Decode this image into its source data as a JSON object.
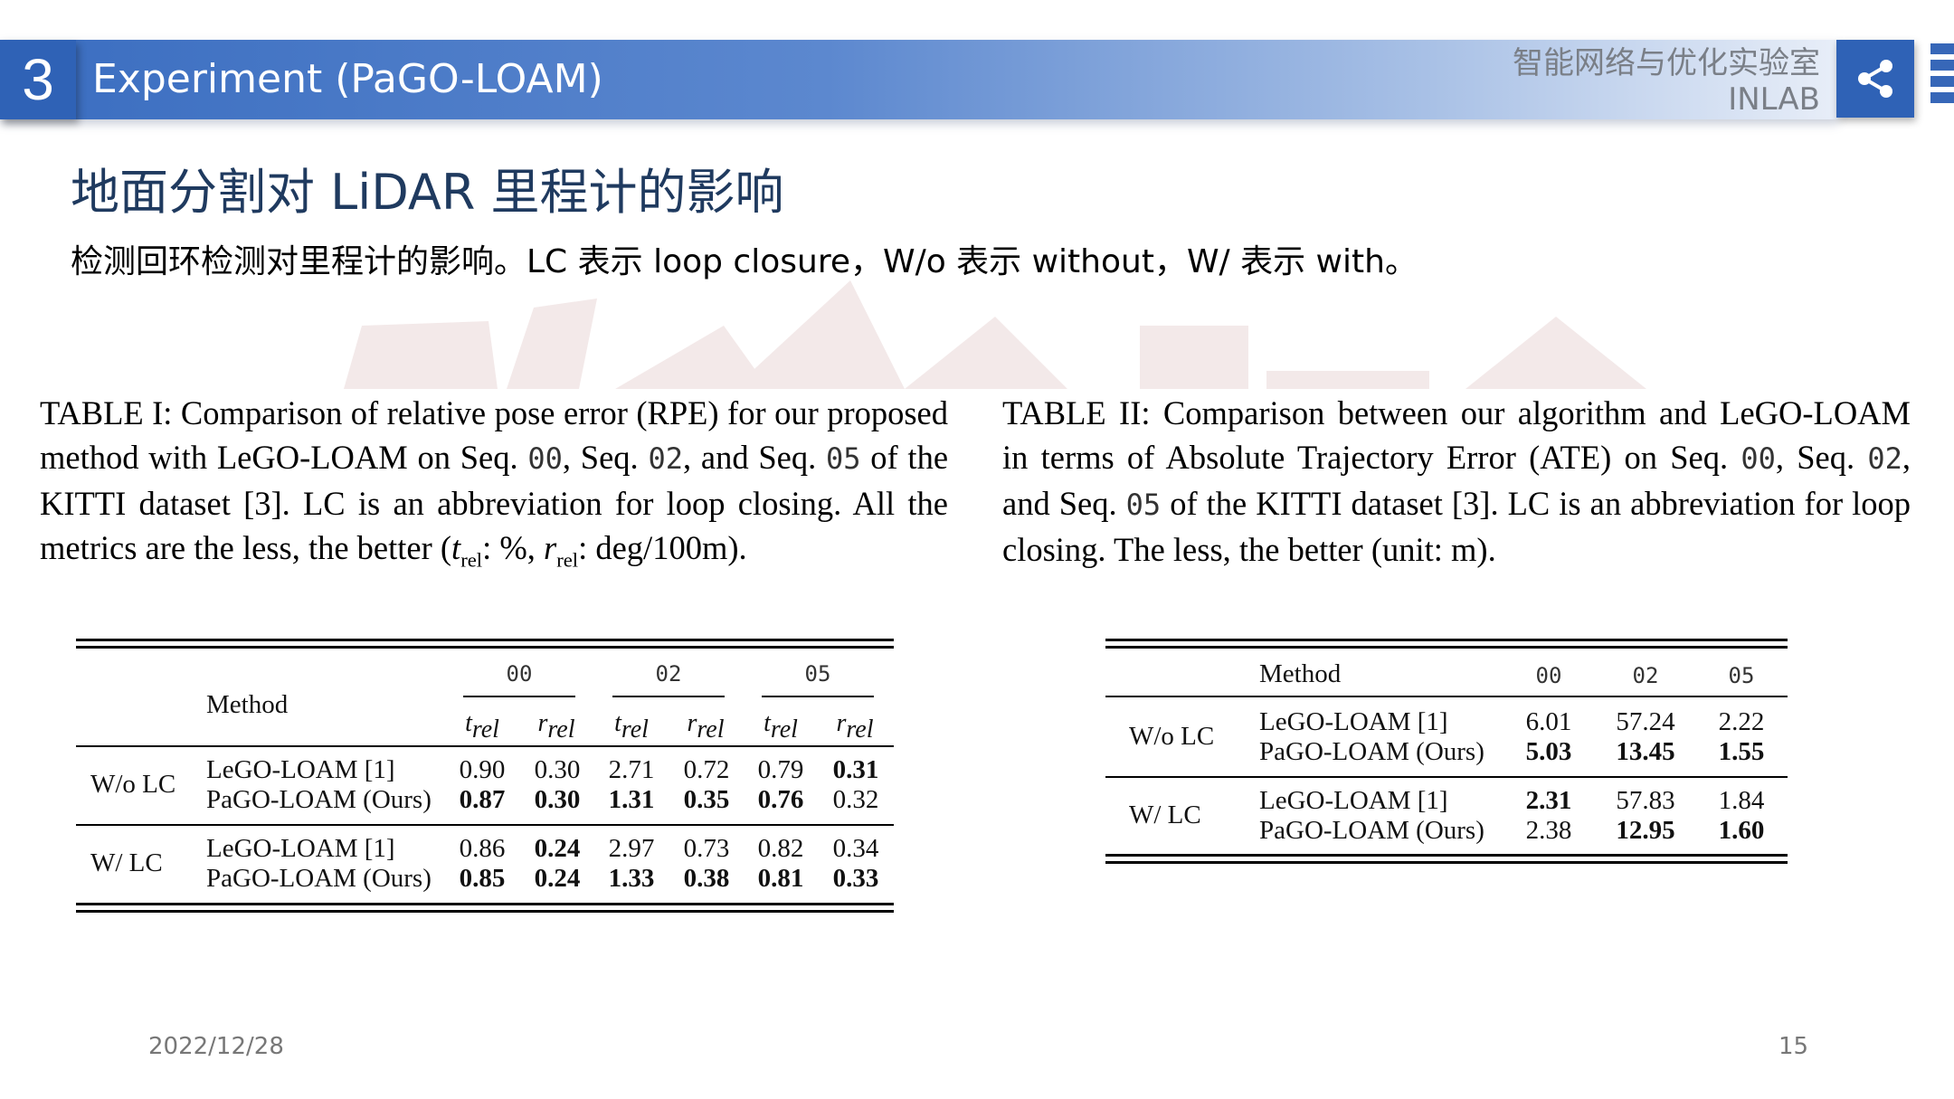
{
  "header": {
    "section_number": "3",
    "title": "Experiment (PaGO-LOAM)",
    "lab_name_cn": "智能网络与优化实验室",
    "lab_name_en": "INLAB"
  },
  "slide": {
    "title": "地面分割对 LiDAR 里程计的影响",
    "subtitle": "检测回环检测对里程计的影响。LC 表示 loop closure，W/o 表示 without，W/ 表示 with。"
  },
  "table1": {
    "caption": {
      "p1": "TABLE I: Comparison of relative pose error (RPE) for our proposed method with LeGO-LOAM on Seq.",
      "seq00": "00",
      "sep1": ", Seq.",
      "seq02": "02",
      "sep2": ", and Seq.",
      "seq05": "05",
      "p2": "of the KITTI dataset [3]. LC is an abbreviation for loop closing. All the metrics are the less, the better (",
      "t_sym": "t",
      "sub": "rel",
      "t_unit": ": %, ",
      "r_sym": "r",
      "r_unit": ": deg/100m)."
    },
    "method_header": "Method",
    "sequences": [
      "00",
      "02",
      "05"
    ],
    "metric_t": "t",
    "metric_r": "r",
    "metric_sub": "rel",
    "groups": [
      {
        "label": "W/o LC",
        "rows": [
          {
            "method": "LeGO-LOAM [1]",
            "values": [
              "0.90",
              "0.30",
              "2.71",
              "0.72",
              "0.79",
              "0.31"
            ],
            "bold": [
              false,
              false,
              false,
              false,
              false,
              true
            ]
          },
          {
            "method": "PaGO-LOAM (Ours)",
            "values": [
              "0.87",
              "0.30",
              "1.31",
              "0.35",
              "0.76",
              "0.32"
            ],
            "bold": [
              true,
              true,
              true,
              true,
              true,
              false
            ]
          }
        ]
      },
      {
        "label": "W/ LC",
        "rows": [
          {
            "method": "LeGO-LOAM [1]",
            "values": [
              "0.86",
              "0.24",
              "2.97",
              "0.73",
              "0.82",
              "0.34"
            ],
            "bold": [
              false,
              true,
              false,
              false,
              false,
              false
            ]
          },
          {
            "method": "PaGO-LOAM (Ours)",
            "values": [
              "0.85",
              "0.24",
              "1.33",
              "0.38",
              "0.81",
              "0.33"
            ],
            "bold": [
              true,
              true,
              true,
              true,
              true,
              true
            ]
          }
        ]
      }
    ]
  },
  "table2": {
    "caption": {
      "p1": "TABLE II: Comparison between our algorithm and LeGO-LOAM in terms of Absolute Trajectory Error (ATE) on Seq.",
      "seq00": "00",
      "sep1": ", Seq.",
      "seq02": "02",
      "sep2": ", and Seq.",
      "seq05": "05",
      "p2": "of the KITTI dataset [3]. LC is an abbreviation for loop closing. The less, the better (unit: m)."
    },
    "method_header": "Method",
    "sequences": [
      "00",
      "02",
      "05"
    ],
    "groups": [
      {
        "label": "W/o LC",
        "rows": [
          {
            "method": "LeGO-LOAM [1]",
            "values": [
              "6.01",
              "57.24",
              "2.22"
            ],
            "bold": [
              false,
              false,
              false
            ]
          },
          {
            "method": "PaGO-LOAM (Ours)",
            "values": [
              "5.03",
              "13.45",
              "1.55"
            ],
            "bold": [
              true,
              true,
              true
            ]
          }
        ]
      },
      {
        "label": "W/ LC",
        "rows": [
          {
            "method": "LeGO-LOAM [1]",
            "values": [
              "2.31",
              "57.83",
              "1.84"
            ],
            "bold": [
              true,
              false,
              false
            ]
          },
          {
            "method": "PaGO-LOAM (Ours)",
            "values": [
              "2.38",
              "12.95",
              "1.60"
            ],
            "bold": [
              false,
              true,
              true
            ]
          }
        ]
      }
    ]
  },
  "footer": {
    "date": "2022/12/28",
    "page_number": "15"
  },
  "colors": {
    "header_blue": "#2f62b6",
    "title_navy": "#1f3a5f"
  }
}
